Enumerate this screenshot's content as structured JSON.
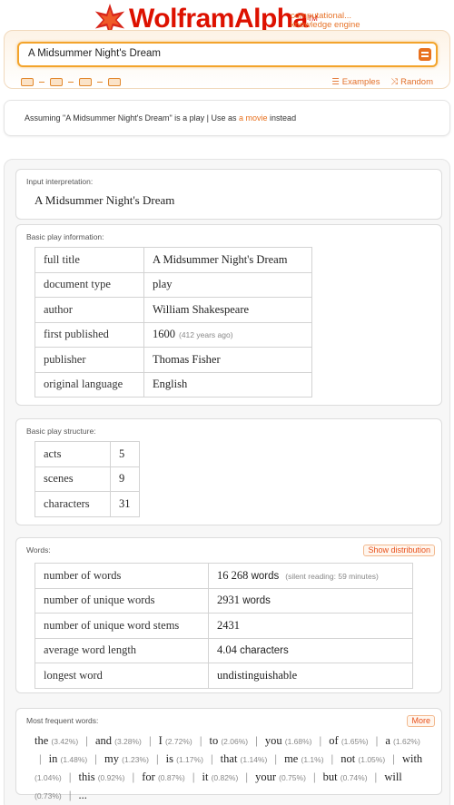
{
  "header": {
    "logo_text": "WolframAlpha",
    "tagline_line1": "computational...",
    "tagline_line2": "knowledge engine",
    "links": [
      {
        "label": "Examples",
        "icon": "list-icon"
      },
      {
        "label": "Random",
        "icon": "shuffle-icon"
      }
    ],
    "tool_icons": [
      "keyboard-icon",
      "camera-icon",
      "table-icon",
      "upload-icon"
    ]
  },
  "search": {
    "value": "A Midsummer Night's Dream"
  },
  "assumption": {
    "prefix": "Assuming \"A Midsummer Night's Dream\" is a play | Use as ",
    "link": "a movie",
    "suffix": " instead"
  },
  "pods": {
    "input": {
      "title": "Input interpretation:",
      "value": "A Midsummer Night's Dream"
    },
    "basic_info": {
      "title": "Basic play information:",
      "rows": [
        {
          "label": "full title",
          "value": "A Midsummer Night's Dream",
          "note": ""
        },
        {
          "label": "document type",
          "value": "play",
          "note": ""
        },
        {
          "label": "author",
          "value": "William Shakespeare",
          "note": ""
        },
        {
          "label": "first published",
          "value": "1600",
          "note": "(412 years ago)"
        },
        {
          "label": "publisher",
          "value": "Thomas Fisher",
          "note": ""
        },
        {
          "label": "original language",
          "value": "English",
          "note": ""
        }
      ]
    },
    "structure": {
      "title": "Basic play structure:",
      "rows": [
        {
          "label": "acts",
          "value": "5"
        },
        {
          "label": "scenes",
          "value": "9"
        },
        {
          "label": "characters",
          "value": "31"
        }
      ]
    },
    "words": {
      "title": "Words:",
      "button": "Show distribution",
      "rows": [
        {
          "label": "number of words",
          "value": "16 268",
          "unit": " words",
          "note": "(silent reading: 59 minutes)"
        },
        {
          "label": "number of unique words",
          "value": "2931",
          "unit": " words",
          "note": ""
        },
        {
          "label": "number of unique word stems",
          "value": "2431",
          "unit": "",
          "note": ""
        },
        {
          "label": "average word length",
          "value": "4.04",
          "unit": " characters",
          "note": ""
        },
        {
          "label": "longest word",
          "value": "undistinguishable",
          "unit": "",
          "note": ""
        }
      ]
    },
    "frequent": {
      "title": "Most frequent words:",
      "button": "More",
      "words": [
        {
          "w": "the",
          "p": "(3.42%)"
        },
        {
          "w": "and",
          "p": "(3.28%)"
        },
        {
          "w": "I",
          "p": "(2.72%)"
        },
        {
          "w": "to",
          "p": "(2.06%)"
        },
        {
          "w": "you",
          "p": "(1.68%)"
        },
        {
          "w": "of",
          "p": "(1.65%)"
        },
        {
          "w": "a",
          "p": "(1.62%)"
        },
        {
          "w": "in",
          "p": "(1.48%)"
        },
        {
          "w": "my",
          "p": "(1.23%)"
        },
        {
          "w": "is",
          "p": "(1.17%)"
        },
        {
          "w": "that",
          "p": "(1.14%)"
        },
        {
          "w": "me",
          "p": "(1.1%)"
        },
        {
          "w": "not",
          "p": "(1.05%)"
        },
        {
          "w": "with",
          "p": "(1.04%)"
        },
        {
          "w": "this",
          "p": "(0.92%)"
        },
        {
          "w": "for",
          "p": "(0.87%)"
        },
        {
          "w": "it",
          "p": "(0.82%)"
        },
        {
          "w": "your",
          "p": "(0.75%)"
        },
        {
          "w": "but",
          "p": "(0.74%)"
        },
        {
          "w": "will",
          "p": "(0.73%)"
        }
      ],
      "ellipsis": "..."
    }
  },
  "colors": {
    "brand": "#dd1100",
    "accent": "#e8711f",
    "search_border": "#f3a42c"
  }
}
